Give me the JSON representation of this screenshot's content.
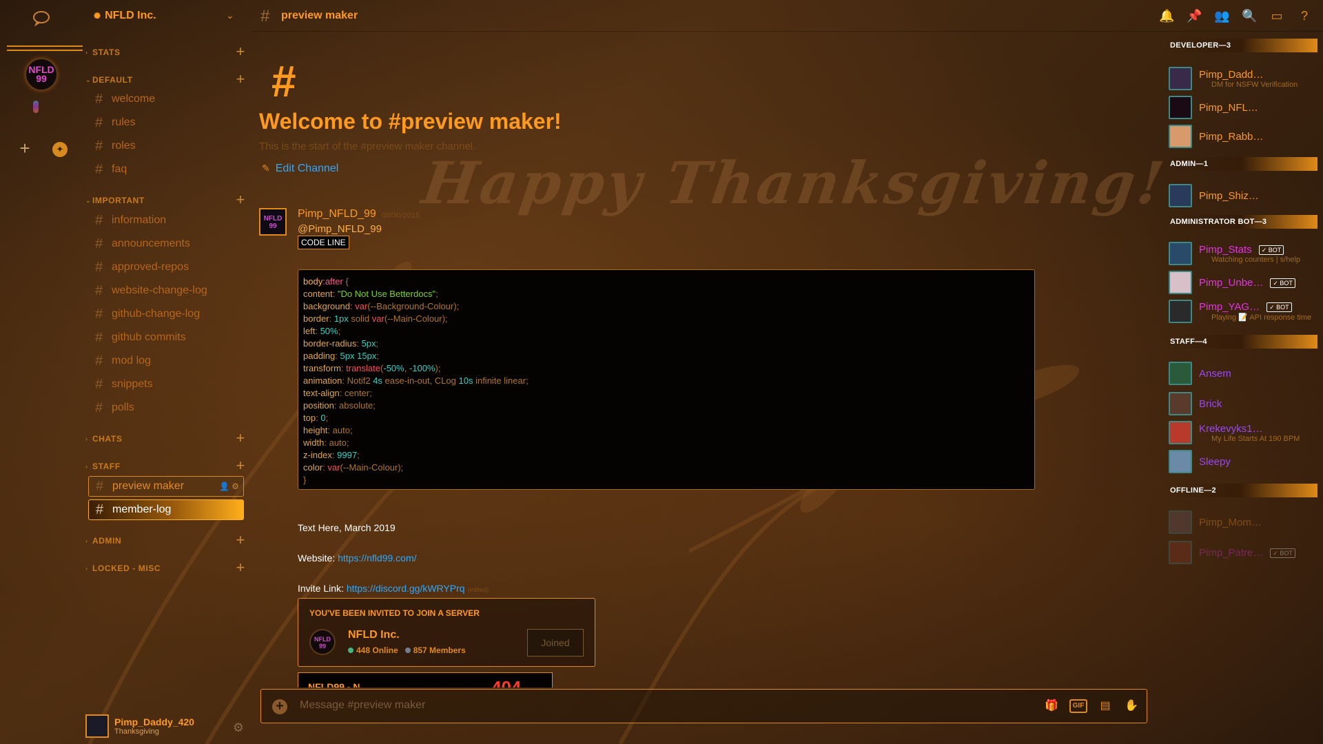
{
  "server": {
    "name": "NFLD Inc.",
    "icon_text": "NFLD 99"
  },
  "sidebar": {
    "categories": {
      "stats": "STATS",
      "default": "DEFAULT",
      "important": "IMPORTANT",
      "chats": "CHATS",
      "staff": "STAFF",
      "admin": "ADMIN",
      "locked": "LOCKED - MISC"
    },
    "default_channels": [
      "welcome",
      "rules",
      "roles",
      "faq"
    ],
    "important_channels": [
      "information",
      "announcements",
      "approved-repos",
      "website-change-log",
      "github-change-log",
      "github commits",
      "mod log",
      "snippets",
      "polls"
    ],
    "staff_channels": [
      "preview maker",
      "member-log"
    ]
  },
  "user": {
    "name": "Pimp_Daddy_420",
    "status": "Thanksgiving"
  },
  "header": {
    "channel": "preview maker"
  },
  "chat": {
    "welcome_title": "Welcome to #preview maker!",
    "welcome_sub": "This is the start of the #preview maker channel.",
    "edit_channel": "Edit Channel",
    "banner_text": "Happy Thanksgiving!",
    "message": {
      "author": "Pimp_NFLD_99",
      "time": "08/30/2018",
      "mention": "@Pimp_NFLD_99",
      "inline_code": "CODE LINE",
      "code": [
        [
          [
            "c-sel",
            "body"
          ],
          [
            "c-ps",
            ":after"
          ],
          [
            "c-pun",
            " {"
          ]
        ],
        [
          [
            "c-prop",
            "content"
          ],
          [
            "c-pun",
            ": "
          ],
          [
            "c-str",
            "\"Do Not Use Betterdocs\""
          ],
          [
            "c-pun",
            ";"
          ]
        ],
        [
          [
            "c-prop",
            "background"
          ],
          [
            "c-pun",
            ": "
          ],
          [
            "c-fn",
            "var"
          ],
          [
            "c-pun",
            "(--Background-Colour);"
          ]
        ],
        [
          [
            "c-prop",
            "border"
          ],
          [
            "c-pun",
            ": "
          ],
          [
            "c-num",
            "1px"
          ],
          [
            "c-kw",
            " solid "
          ],
          [
            "c-fn",
            "var"
          ],
          [
            "c-pun",
            "(--Main-Colour);"
          ]
        ],
        [
          [
            "c-prop",
            "left"
          ],
          [
            "c-pun",
            ": "
          ],
          [
            "c-num",
            "50%"
          ],
          [
            "c-pun",
            ";"
          ]
        ],
        [
          [
            "c-prop",
            "border-radius"
          ],
          [
            "c-pun",
            ": "
          ],
          [
            "c-num",
            "5px"
          ],
          [
            "c-pun",
            ";"
          ]
        ],
        [
          [
            "c-prop",
            "padding"
          ],
          [
            "c-pun",
            ": "
          ],
          [
            "c-num",
            "5px 15px"
          ],
          [
            "c-pun",
            ";"
          ]
        ],
        [
          [
            "c-prop",
            "transform"
          ],
          [
            "c-pun",
            ": "
          ],
          [
            "c-fn",
            "translate"
          ],
          [
            "c-pun",
            "("
          ],
          [
            "c-num",
            "-50%"
          ],
          [
            "c-pun",
            ", "
          ],
          [
            "c-num",
            "-100%"
          ],
          [
            "c-pun",
            ");"
          ]
        ],
        [
          [
            "c-prop",
            "animation"
          ],
          [
            "c-pun",
            ": "
          ],
          [
            "c-kw",
            "Notif2 "
          ],
          [
            "c-num",
            "4s"
          ],
          [
            "c-kw",
            " ease-in-out, CLog "
          ],
          [
            "c-num",
            "10s"
          ],
          [
            "c-kw",
            " infinite linear;"
          ]
        ],
        [
          [
            "c-prop",
            "text-align"
          ],
          [
            "c-pun",
            ": "
          ],
          [
            "c-kw",
            "center;"
          ]
        ],
        [
          [
            "c-prop",
            "position"
          ],
          [
            "c-pun",
            ": "
          ],
          [
            "c-kw",
            "absolute;"
          ]
        ],
        [
          [
            "c-prop",
            "top"
          ],
          [
            "c-pun",
            ": "
          ],
          [
            "c-num",
            "0"
          ],
          [
            "c-pun",
            ";"
          ]
        ],
        [
          [
            "c-prop",
            "height"
          ],
          [
            "c-pun",
            ": "
          ],
          [
            "c-kw",
            "auto;"
          ]
        ],
        [
          [
            "c-prop",
            "width"
          ],
          [
            "c-pun",
            ": "
          ],
          [
            "c-kw",
            "auto;"
          ]
        ],
        [
          [
            "c-prop",
            "z-index"
          ],
          [
            "c-pun",
            ": "
          ],
          [
            "c-num",
            "9997"
          ],
          [
            "c-pun",
            ";"
          ]
        ],
        [
          [
            "c-prop",
            "color"
          ],
          [
            "c-pun",
            ": "
          ],
          [
            "c-fn",
            "var"
          ],
          [
            "c-pun",
            "(--Main-Colour);"
          ]
        ],
        [
          [
            "c-pun",
            "}"
          ]
        ]
      ],
      "text_line": "Text Here, March 2019",
      "website_label": "Website: ",
      "website_url": "https://nfld99.com/",
      "invite_label": "Invite Link: ",
      "invite_url": "https://discord.gg/kWRYPrq",
      "edited": "(edited)"
    },
    "invite": {
      "header": "YOU'VE BEEN INVITED TO JOIN A SERVER",
      "server": "NFLD Inc.",
      "online": "448 Online",
      "members": "857 Members",
      "button": "Joined"
    },
    "embed_peek_left": "NFLD99 - N",
    "embed_peek_right": "404",
    "composer_placeholder": "Message #preview maker"
  },
  "members": {
    "groups": [
      {
        "title": "DEVELOPER—3",
        "people": [
          {
            "name": "Pimp_Dadd…",
            "status": "DM for NSFW Verification",
            "color": "#ff9a1f"
          },
          {
            "name": "Pimp_NFL…",
            "status": "",
            "color": "#ff9a1f"
          },
          {
            "name": "Pimp_Rabb…",
            "status": "",
            "color": "#ff9a1f"
          }
        ]
      },
      {
        "title": "ADMIN—1",
        "people": [
          {
            "name": "Pimp_Shiz…",
            "status": "",
            "color": "#ff9a1f"
          }
        ]
      },
      {
        "title": "ADMINISTRATOR BOT—3",
        "people": [
          {
            "name": "Pimp_Stats",
            "status": "Watching counters | s/help",
            "color": "#e632e6",
            "bot": "✓ BOT"
          },
          {
            "name": "Pimp_Unbe…",
            "status": "",
            "color": "#e632e6",
            "bot": "✓ BOT"
          },
          {
            "name": "Pimp_YAG…",
            "status": "Playing 📝 API response time",
            "color": "#e632e6",
            "bot": "✓ BOT"
          }
        ]
      },
      {
        "title": "STAFF—4",
        "people": [
          {
            "name": "Ansem",
            "status": "",
            "color": "#9a44ff"
          },
          {
            "name": "Brick",
            "status": "",
            "color": "#9a44ff"
          },
          {
            "name": "Krekevyks1…",
            "status": "My Life Starts At 190 BPM",
            "color": "#9a44ff"
          },
          {
            "name": "Sleepy",
            "status": "",
            "color": "#9a44ff"
          }
        ]
      },
      {
        "title": "OFFLINE—2",
        "people": [
          {
            "name": "Pimp_Mom…",
            "status": "",
            "color": "#ff9a1f"
          },
          {
            "name": "Pimp_Patre…",
            "status": "",
            "color": "#e632e6",
            "bot": "✓ BOT"
          }
        ]
      }
    ]
  },
  "colors": {
    "accent": "#ff9a1f",
    "link": "#2aa9ff",
    "online_dot": "#43b581",
    "members_dot": "#747f8d"
  }
}
